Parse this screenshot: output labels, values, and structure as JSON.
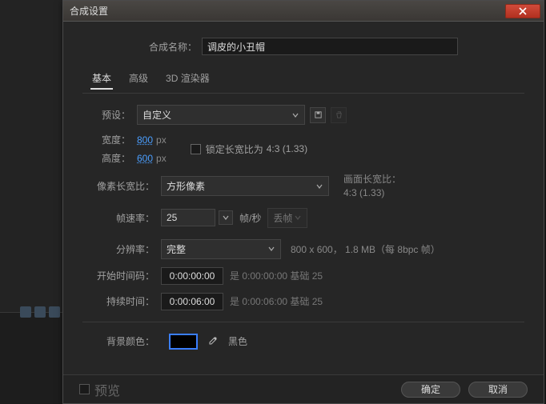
{
  "dialog": {
    "title": "合成设置",
    "compNameLabel": "合成名称：",
    "compName": "调皮的小丑帽",
    "tabs": [
      "基本",
      "高级",
      "3D 渲染器"
    ],
    "presetLabel": "预设：",
    "presetValue": "自定义",
    "widthLabel": "宽度：",
    "widthValue": "800",
    "heightLabel": "高度：",
    "heightValue": "600",
    "pxUnit": "px",
    "lockAspectLabel": "锁定长宽比为",
    "lockAspectRatio": "4:3 (1.33)",
    "parLabel": "像素长宽比：",
    "parValue": "方形像素",
    "frameAspectLabel": "画面长宽比：",
    "frameAspectValue": "4:3 (1.33)",
    "fpsLabel": "帧速率：",
    "fpsValue": "25",
    "fpsUnit": "帧/秒",
    "fpsMode": "丢帧",
    "resLabel": "分辨率：",
    "resValue": "完整",
    "resInfo": "800 x 600， 1.8 MB（每 8bpc 帧）",
    "startTcLabel": "开始时间码：",
    "startTcValue": "0:00:00:00",
    "startTcNote": "是 0:00:00:00  基础 25",
    "durationLabel": "持续时间：",
    "durationValue": "0:00:06:00",
    "durationNote": "是 0:00:06:00  基础 25",
    "bgLabel": "背景颜色：",
    "bgColorName": "黑色",
    "previewLabel": "预览",
    "okLabel": "确定",
    "cancelLabel": "取消"
  }
}
